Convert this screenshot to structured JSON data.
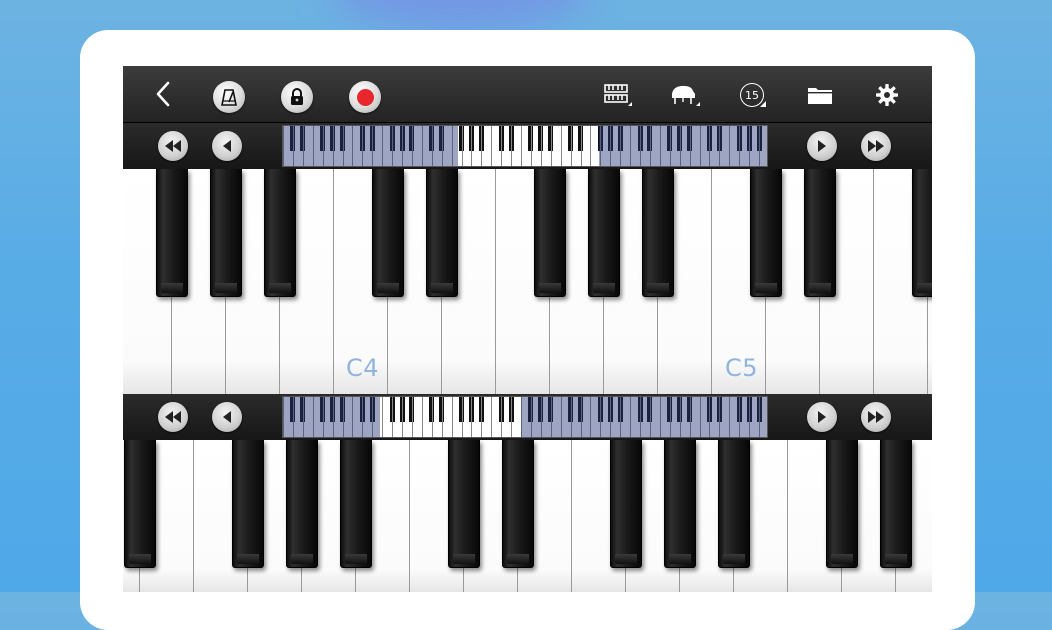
{
  "toolbar": {
    "icons": [
      "back-chevron-icon",
      "metronome-icon",
      "lock-icon",
      "record-icon",
      "keyboard-layout-icon",
      "grand-piano-icon",
      "15",
      "folder-icon",
      "gear-icon"
    ],
    "transpose_value": "15",
    "record_color": "#e8262b"
  },
  "keyboard_top": {
    "label_c4": "C4",
    "label_c5": "C5",
    "nav_buttons": [
      "fast-rewind-icon",
      "rewind-icon",
      "play-icon",
      "fast-forward-icon"
    ],
    "visible_window": {
      "start": 0.36,
      "end": 0.65
    }
  },
  "keyboard_bottom": {
    "nav_buttons": [
      "fast-rewind-icon",
      "rewind-icon",
      "play-icon",
      "fast-forward-icon"
    ],
    "visible_window": {
      "start": 0.2,
      "end": 0.49
    }
  },
  "colors": {
    "label": "#8fb4dd",
    "toolbar": "#2e2e2e",
    "background": "#58ace6"
  }
}
